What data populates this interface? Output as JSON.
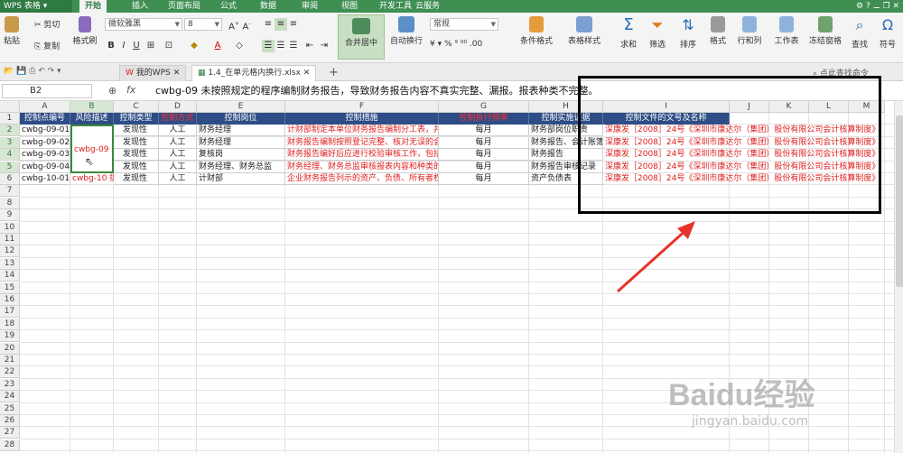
{
  "app": {
    "name": "WPS 表格",
    "menu_tabs": [
      "开始",
      "插入",
      "页面布局",
      "公式",
      "数据",
      "审阅",
      "视图",
      "开发工具",
      "云服务"
    ],
    "active_tab": "开始"
  },
  "ribbon": {
    "paste": "粘贴",
    "cut": "剪切",
    "copy": "复制",
    "format_painter": "格式刷",
    "font_name": "微软雅黑",
    "font_size": "8",
    "merge_center": "合并居中",
    "auto_wrap": "自动换行",
    "number_format": "常规",
    "conditional_format": "条件格式",
    "table_style": "表格样式",
    "sum": "求和",
    "filter": "筛选",
    "sort": "排序",
    "format": "格式",
    "rows_cols": "行和列",
    "worksheet": "工作表",
    "freeze": "冻结窗格",
    "find": "查找",
    "symbol": "符号"
  },
  "doc_tabs": [
    "我的WPS",
    "1.4_在单元格内换行.xlsx"
  ],
  "search_hint": "点此查找命令",
  "name_box": "B2",
  "formula": "cwbg-09 未按照规定的程序编制财务报告，导致财务报告内容不真实完整、漏报。报表种类不完整。",
  "columns": [
    "A",
    "B",
    "C",
    "D",
    "E",
    "F",
    "G",
    "H",
    "I",
    "J",
    "K",
    "L",
    "M"
  ],
  "rows": [
    "1",
    "2",
    "3",
    "4",
    "5",
    "6",
    "7",
    "8",
    "9",
    "10",
    "11",
    "12",
    "13",
    "14",
    "15",
    "16",
    "17",
    "18",
    "19",
    "20",
    "21",
    "22",
    "23",
    "24",
    "25",
    "26",
    "27",
    "28"
  ],
  "table": {
    "headers": [
      "控制点编号",
      "风险描述",
      "控制类型",
      "控制方式",
      "控制岗位",
      "控制措施",
      "控制执行频率",
      "控制实施证据",
      "控制文件的文号及名称"
    ],
    "ids": [
      "cwbg-09-01",
      "cwbg-09-02",
      "cwbg-09-03",
      "cwbg-09-04",
      "cwbg-10-01"
    ],
    "risk_b": [
      "cwbg-09 未",
      "cwbg-10 提"
    ],
    "type": [
      "发现性",
      "发现性",
      "发现性",
      "发现性",
      "发现性"
    ],
    "mode": [
      "人工",
      "人工",
      "人工",
      "人工",
      "人工"
    ],
    "post": [
      "财务经理",
      "财务经理",
      "复核岗",
      "财务经理、财务总监",
      "计财部"
    ],
    "measure": [
      "计财部制定本单位财务报告编制分工表，并",
      "财务报告编制按照登记完整、核对无误的会",
      "财务报告编好后应进行校验审核工作，包括",
      "财务经理、财务总监审核报表内容和种类的",
      "企业财务报告列示的资产、负债、所有者权"
    ],
    "freq": [
      "每月",
      "每月",
      "每月",
      "每月",
      "每月"
    ],
    "evidence": [
      "财务部岗位职责",
      "财务报告、会计账簿",
      "财务报告",
      "财务报告审核记录",
      "资产负债表"
    ],
    "doc_name": [
      "深康发［2008］24号《深圳市康达尔（集团）股份有限公司会计核算制度》",
      "深康发［2008］24号《深圳市康达尔（集团）股份有限公司会计核算制度》",
      "深康发［2008］24号《深圳市康达尔（集团）股份有限公司会计核算制度》",
      "深康发［2008］24号《深圳市康达尔（集团）股份有限公司会计核算制度》",
      "深康发［2008］24号《深圳市康达尔（集团）股份有限公司会计核算制度》"
    ]
  },
  "watermark": {
    "brand": "Baidu经验",
    "url": "jingyan.baidu.com"
  },
  "colors": {
    "brand_green": "#3f8f53",
    "header_navy": "#2e4d86",
    "text_red": "#e02020",
    "annotation": "#000000",
    "arrow": "#e8332a"
  }
}
